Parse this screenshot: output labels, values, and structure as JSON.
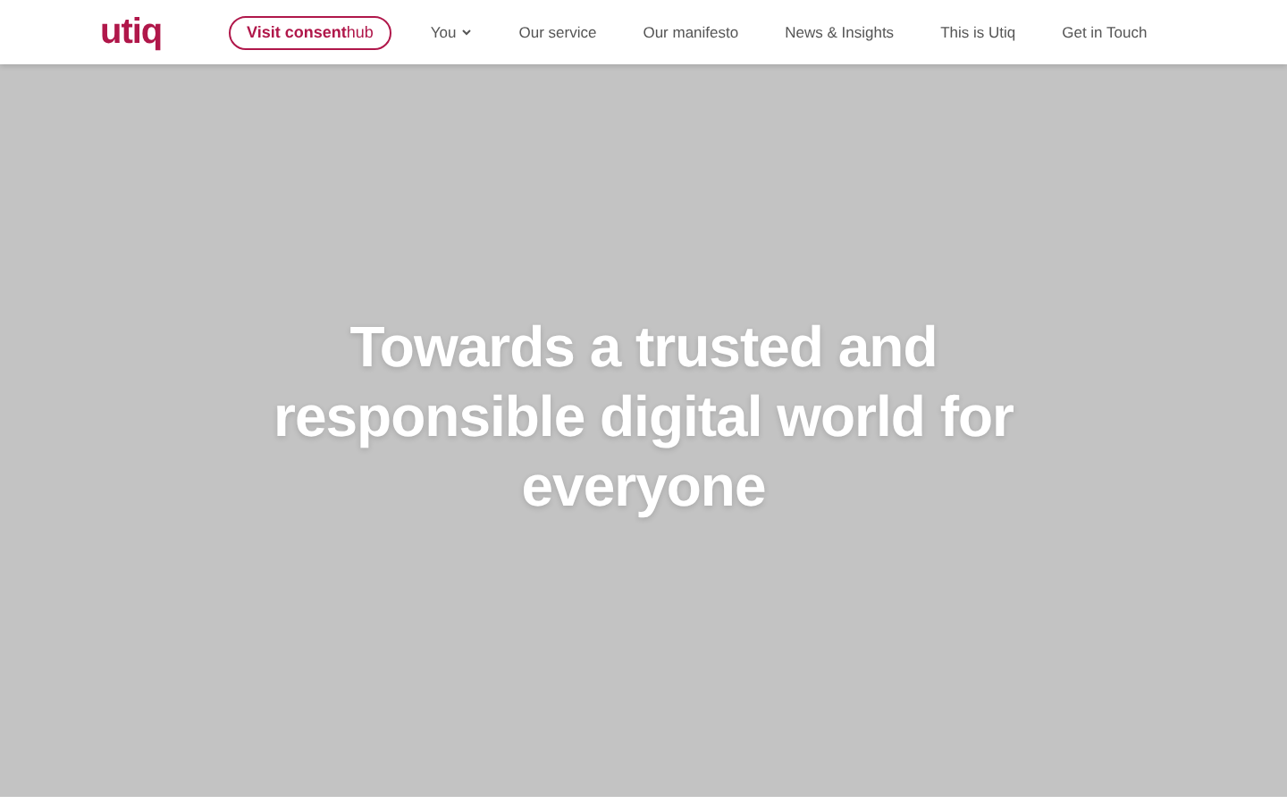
{
  "header": {
    "logo": "utiq",
    "consent_button": "**Visit** **consent**hub",
    "nav": [
      {
        "label": "You",
        "dropdown": true
      },
      {
        "label": "Our service",
        "dropdown": false
      },
      {
        "label": "Our manifesto",
        "dropdown": false
      },
      {
        "label": "News & Insights",
        "dropdown": false
      },
      {
        "label": "This is Utiq",
        "dropdown": false
      },
      {
        "label": "Get in Touch",
        "dropdown": false
      }
    ]
  },
  "hero": {
    "heading": "Towards a trusted and responsible digital world for everyone"
  }
}
